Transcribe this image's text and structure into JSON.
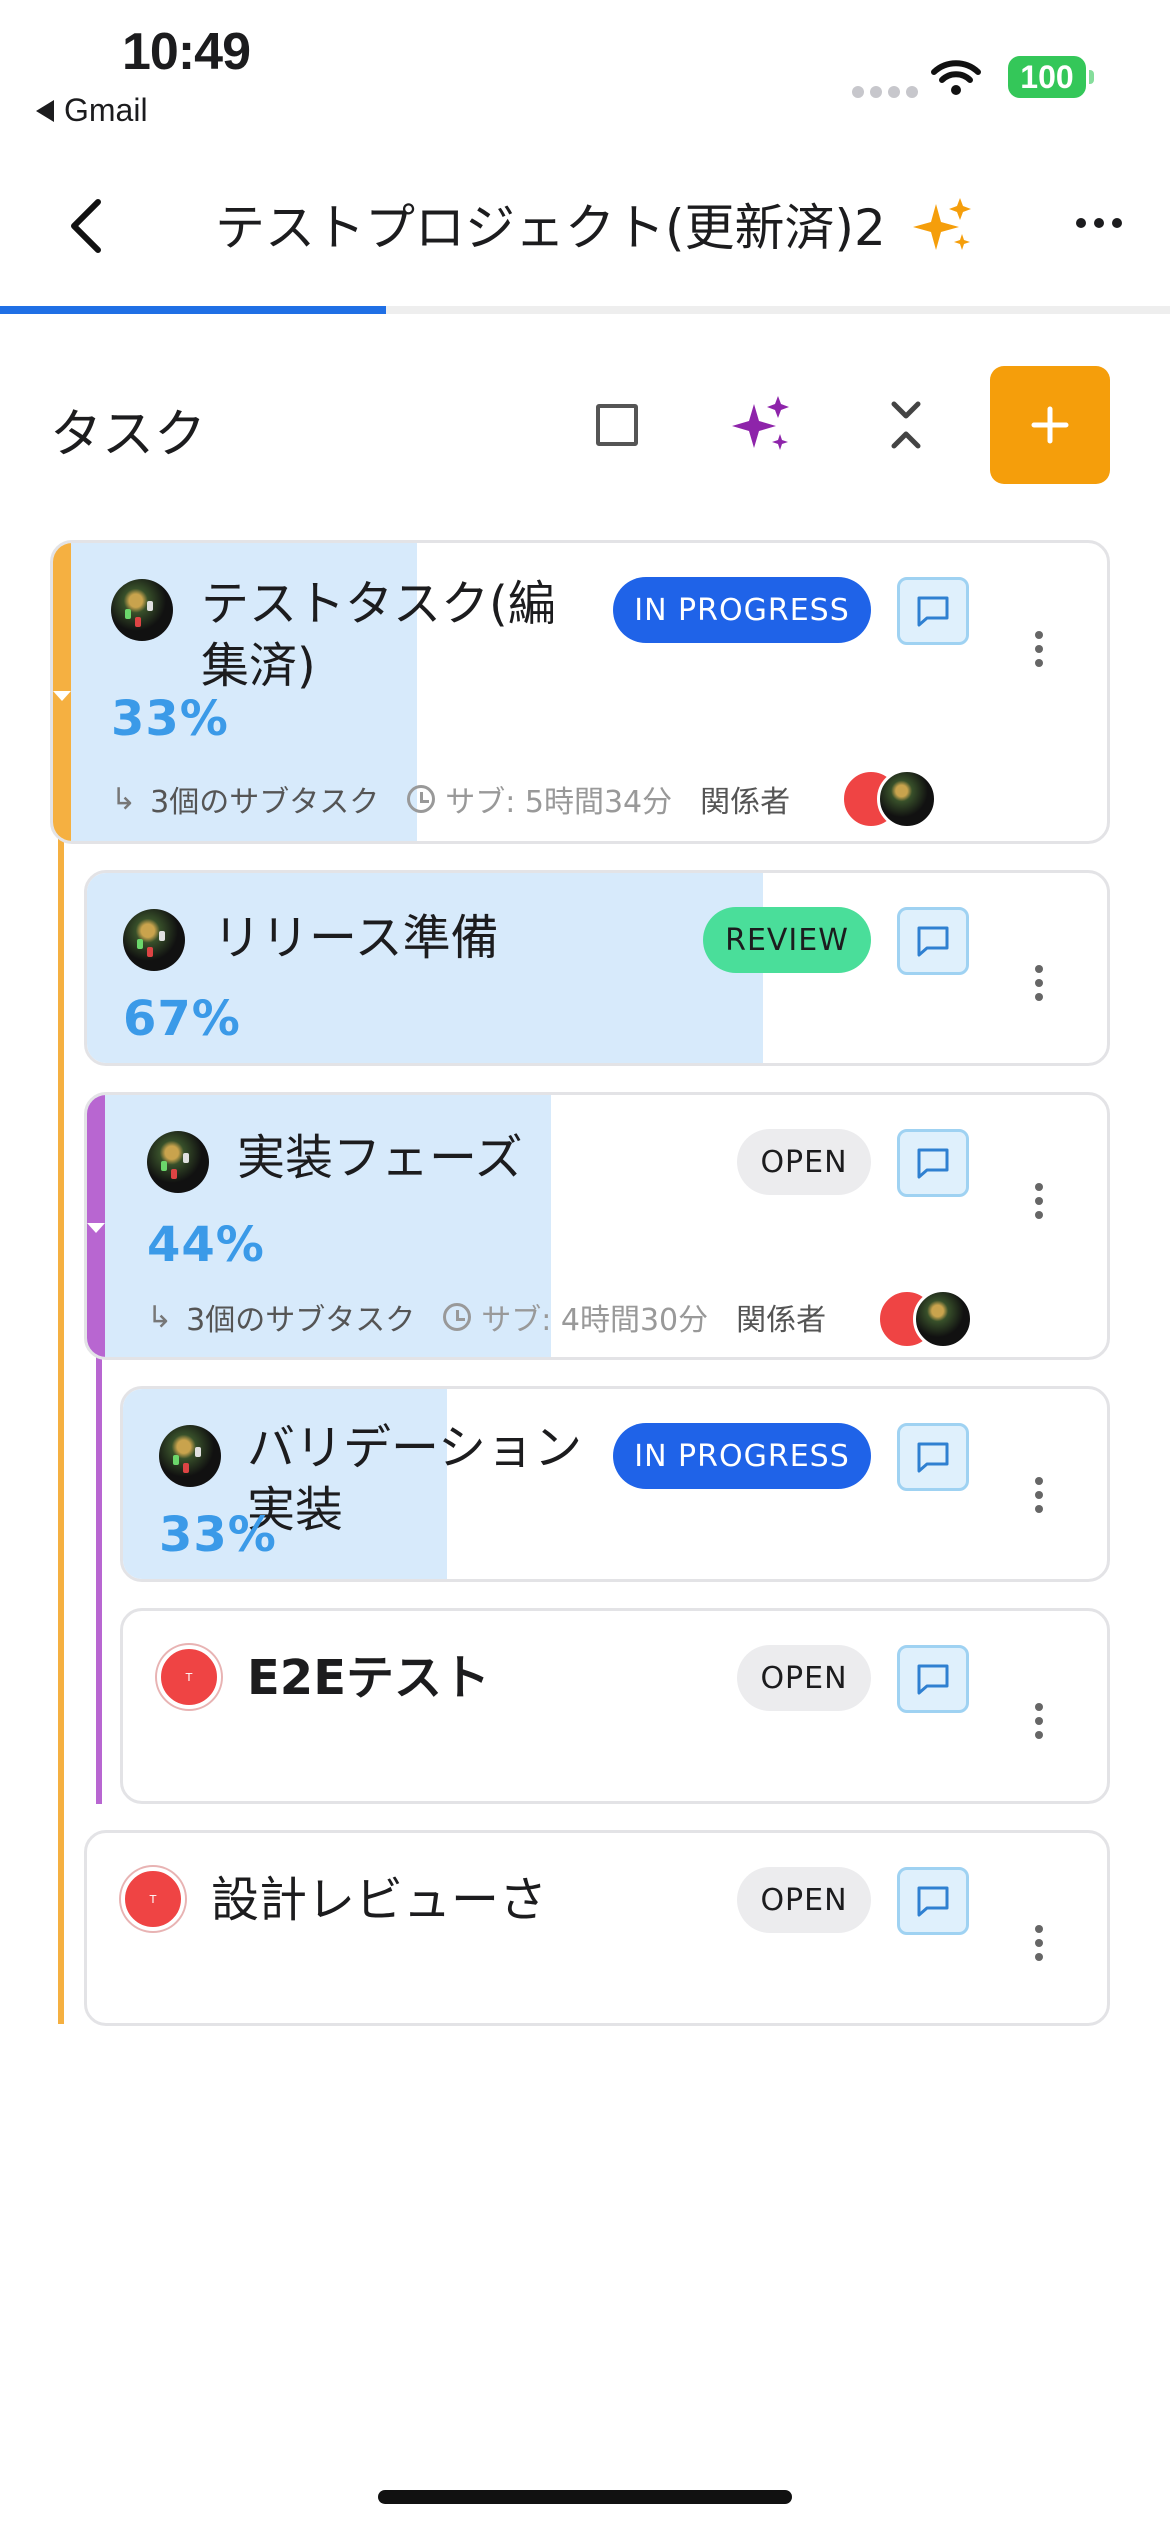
{
  "status_bar": {
    "time": "10:49",
    "back_app": "Gmail",
    "battery": "100"
  },
  "header": {
    "title": "テストプロジェクト(更新済)2",
    "progress_fraction": 0.33
  },
  "toolbar": {
    "heading": "タスク"
  },
  "colors": {
    "accent_orange": "#f59e0b",
    "primary_blue": "#1f63e8",
    "progress_blue": "#3b9ae8",
    "review_green": "#4ade9a",
    "tree_orange": "#f5b041",
    "tree_purple": "#b866d1"
  },
  "tasks": [
    {
      "title": "テストタスク(編集済)",
      "status": "IN PROGRESS",
      "percent": "33%",
      "subtasks": "3個のサブタスク",
      "sub_time": "サブ: 5時間34分",
      "members_label": "関係者",
      "avatar": "photo",
      "depth": 0
    },
    {
      "title": "リリース準備",
      "status": "REVIEW",
      "percent": "67%",
      "avatar": "photo",
      "depth": 1
    },
    {
      "title": "実装フェーズ",
      "status": "OPEN",
      "percent": "44%",
      "subtasks": "3個のサブタスク",
      "sub_time": "サブ: 4時間30分",
      "members_label": "関係者",
      "avatar": "photo",
      "depth": 1
    },
    {
      "title": "バリデーション実装",
      "status": "IN PROGRESS",
      "percent": "33%",
      "avatar": "photo",
      "depth": 2
    },
    {
      "title": "E2Eテスト",
      "status": "OPEN",
      "avatar": "T",
      "depth": 2
    },
    {
      "title": "設計レビューさ",
      "status": "OPEN",
      "avatar": "T",
      "depth": 1
    }
  ]
}
